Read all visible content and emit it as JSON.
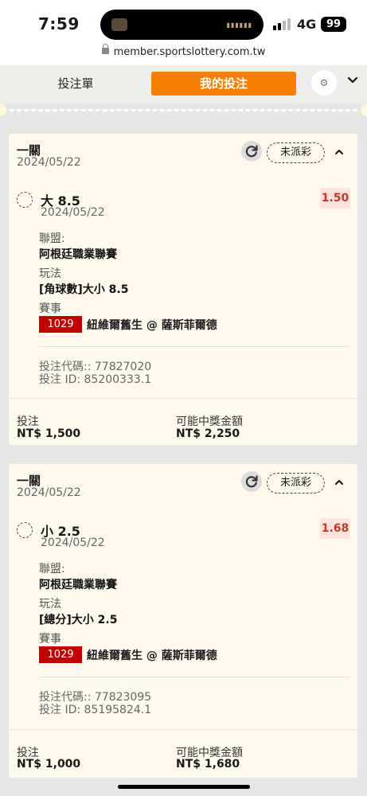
{
  "status_bar": {
    "time": "7:59",
    "network": "4G",
    "battery": "99"
  },
  "url": "member.sportslottery.com.tw",
  "tabs": {
    "slip": "投注單",
    "mybets": "我的投注"
  },
  "bets": [
    {
      "type": "一關",
      "date": "2024/05/22",
      "status": "未派彩",
      "selection": "大 8.5",
      "selection_date": "2024/05/22",
      "odds": "1.50",
      "league_label": "聯盟:",
      "league": "阿根廷職業聯賽",
      "market_label": "玩法",
      "market": "[角球數]大小 8.5",
      "event_label": "賽事",
      "event_no": "1029",
      "event_name": "紐維爾舊生 @ 薩斯菲爾德",
      "bet_code": "投注代碼:: 77827020",
      "bet_id": "投注 ID: 85200333.1",
      "stake_label": "投注",
      "stake": "NT$ 1,500",
      "payout_label": "可能中獎金額",
      "payout": "NT$ 2,250"
    },
    {
      "type": "一關",
      "date": "2024/05/22",
      "status": "未派彩",
      "selection": "小 2.5",
      "selection_date": "2024/05/22",
      "odds": "1.68",
      "league_label": "聯盟:",
      "league": "阿根廷職業聯賽",
      "market_label": "玩法",
      "market": "[總分]大小 2.5",
      "event_label": "賽事",
      "event_no": "1029",
      "event_name": "紐維爾舊生 @ 薩斯菲爾德",
      "bet_code": "投注代碼:: 77823095",
      "bet_id": "投注 ID: 85195824.1",
      "stake_label": "投注",
      "stake": "NT$ 1,000",
      "payout_label": "可能中獎金額",
      "payout": "NT$ 1,680"
    }
  ],
  "colors": {
    "accent": "#f77f00",
    "odds_text": "#c0392b",
    "event_badge": "#c00000",
    "card_bg": "#fffaed"
  }
}
